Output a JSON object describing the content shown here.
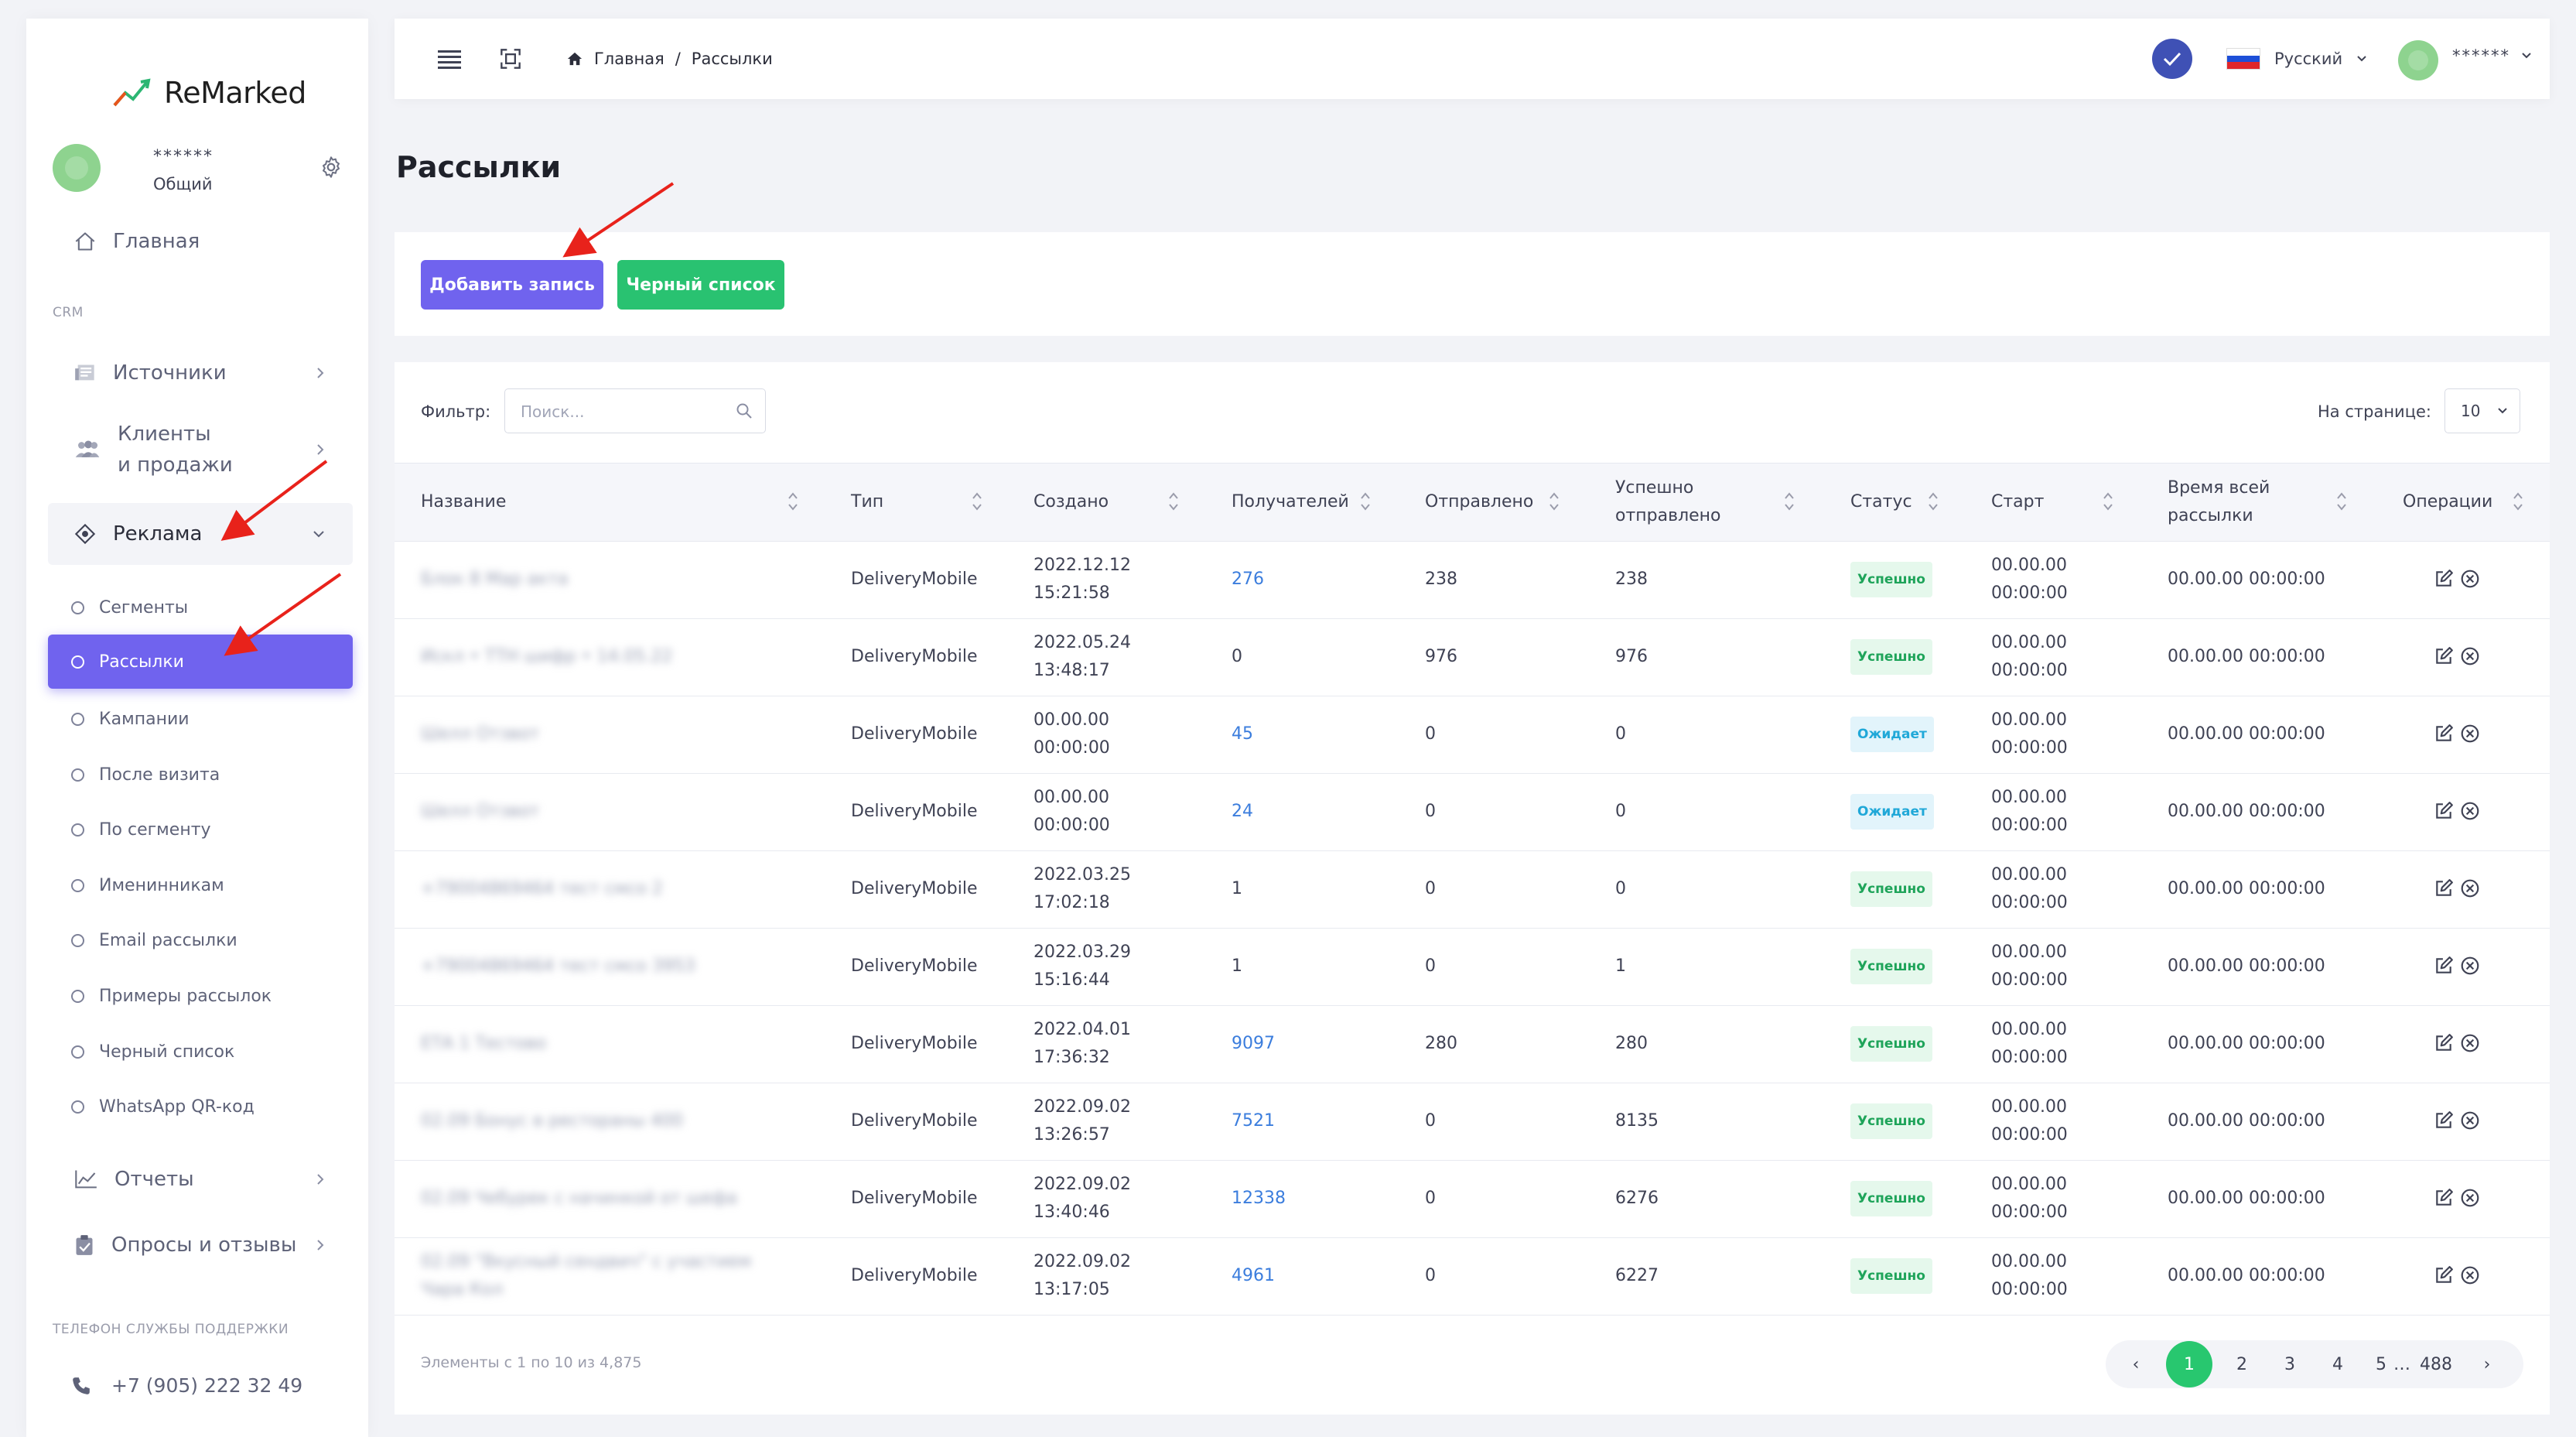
{
  "brand": {
    "name": "ReMarked"
  },
  "user": {
    "name": "******",
    "role": "Общий"
  },
  "sidebar": {
    "home": "Главная",
    "section_crm": "CRM",
    "sources": "Источники",
    "clients_line1": "Клиенты",
    "clients_line2": "и продажи",
    "ads": "Реклама",
    "sub_items": [
      "Сегменты",
      "Рассылки",
      "Кампании",
      "После визита",
      "По сегменту",
      "Именинникам",
      "Email рассылки",
      "Примеры рассылок",
      "Черный список",
      "WhatsApp QR-код"
    ],
    "reports": "Отчеты",
    "surveys": "Опросы и отзывы",
    "support_label": "ТЕЛЕФОН СЛУЖБЫ ПОДДЕРЖКИ",
    "support_phone": "+7 (905) 222 32 49"
  },
  "header": {
    "breadcrumb": [
      "Главная",
      "/",
      "Рассылки"
    ],
    "language": "Русский",
    "user": "******"
  },
  "page": {
    "title": "Рассылки",
    "add_button": "Добавить запись",
    "blacklist_button": "Черный список"
  },
  "table": {
    "filter_label": "Фильтр:",
    "search_placeholder": "Поиск...",
    "per_page_label": "На странице:",
    "per_page_value": "10",
    "columns": [
      {
        "l1": "Название",
        "l2": ""
      },
      {
        "l1": "Тип",
        "l2": ""
      },
      {
        "l1": "Создано",
        "l2": ""
      },
      {
        "l1": "Получателей",
        "l2": ""
      },
      {
        "l1": "Отправлено",
        "l2": ""
      },
      {
        "l1": "Успешно",
        "l2": "отправлено"
      },
      {
        "l1": "Статус",
        "l2": ""
      },
      {
        "l1": "Старт",
        "l2": ""
      },
      {
        "l1": "Время всей",
        "l2": "рассылки"
      },
      {
        "l1": "Операции",
        "l2": ""
      }
    ],
    "rows": [
      {
        "name": "Блок 8 Мар акта",
        "name2": "",
        "type": "DeliveryMobile",
        "created_date": "2022.12.12",
        "created_time": "15:21:58",
        "recipients": "276",
        "recipients_link": true,
        "sent": "238",
        "success": "238",
        "status": "Успешно",
        "status_kind": "ok",
        "start_date": "00.00.00",
        "start_time": "00:00:00",
        "total": "00.00.00 00:00:00"
      },
      {
        "name": "Искл • ТТН шифр • 14.05.22",
        "name2": "",
        "type": "DeliveryMobile",
        "created_date": "2022.05.24",
        "created_time": "13:48:17",
        "recipients": "0",
        "recipients_link": false,
        "sent": "976",
        "success": "976",
        "status": "Успешно",
        "status_kind": "ok",
        "start_date": "00.00.00",
        "start_time": "00:00:00",
        "total": "00.00.00 00:00:00"
      },
      {
        "name": "Шелл Отзвот",
        "name2": "",
        "type": "DeliveryMobile",
        "created_date": "00.00.00",
        "created_time": "00:00:00",
        "recipients": "45",
        "recipients_link": true,
        "sent": "0",
        "success": "0",
        "status": "Ожидает",
        "status_kind": "wait",
        "start_date": "00.00.00",
        "start_time": "00:00:00",
        "total": "00.00.00 00:00:00"
      },
      {
        "name": "Шелл Отзвот",
        "name2": "",
        "type": "DeliveryMobile",
        "created_date": "00.00.00",
        "created_time": "00:00:00",
        "recipients": "24",
        "recipients_link": true,
        "sent": "0",
        "success": "0",
        "status": "Ожидает",
        "status_kind": "wait",
        "start_date": "00.00.00",
        "start_time": "00:00:00",
        "total": "00.00.00 00:00:00"
      },
      {
        "name": "+79004869464 тест смсо 2",
        "name2": "",
        "type": "DeliveryMobile",
        "created_date": "2022.03.25",
        "created_time": "17:02:18",
        "recipients": "1",
        "recipients_link": false,
        "sent": "0",
        "success": "0",
        "status": "Успешно",
        "status_kind": "ok",
        "start_date": "00.00.00",
        "start_time": "00:00:00",
        "total": "00.00.00 00:00:00"
      },
      {
        "name": "+79004869464 тест смсо 3953",
        "name2": "",
        "type": "DeliveryMobile",
        "created_date": "2022.03.29",
        "created_time": "15:16:44",
        "recipients": "1",
        "recipients_link": false,
        "sent": "0",
        "success": "1",
        "status": "Успешно",
        "status_kind": "ok",
        "start_date": "00.00.00",
        "start_time": "00:00:00",
        "total": "00.00.00 00:00:00"
      },
      {
        "name": "ЕТА 1 Тестово",
        "name2": "",
        "type": "DeliveryMobile",
        "created_date": "2022.04.01",
        "created_time": "17:36:32",
        "recipients": "9097",
        "recipients_link": true,
        "sent": "280",
        "success": "280",
        "status": "Успешно",
        "status_kind": "ok",
        "start_date": "00.00.00",
        "start_time": "00:00:00",
        "total": "00.00.00 00:00:00"
      },
      {
        "name": "02.09 Бонус в рестораны 400",
        "name2": "",
        "type": "DeliveryMobile",
        "created_date": "2022.09.02",
        "created_time": "13:26:57",
        "recipients": "7521",
        "recipients_link": true,
        "sent": "0",
        "success": "8135",
        "status": "Успешно",
        "status_kind": "ok",
        "start_date": "00.00.00",
        "start_time": "00:00:00",
        "total": "00.00.00 00:00:00"
      },
      {
        "name": "02.09 Чебурек с начинкой от шефа",
        "name2": "",
        "type": "DeliveryMobile",
        "created_date": "2022.09.02",
        "created_time": "13:40:46",
        "recipients": "12338",
        "recipients_link": true,
        "sent": "0",
        "success": "6276",
        "status": "Успешно",
        "status_kind": "ok",
        "start_date": "00.00.00",
        "start_time": "00:00:00",
        "total": "00.00.00 00:00:00"
      },
      {
        "name": "02.09 \"Вкусный сендвич\" с участием",
        "name2": "Чара Кол",
        "type": "DeliveryMobile",
        "created_date": "2022.09.02",
        "created_time": "13:17:05",
        "recipients": "4961",
        "recipients_link": true,
        "sent": "0",
        "success": "6227",
        "status": "Успешно",
        "status_kind": "ok",
        "start_date": "00.00.00",
        "start_time": "00:00:00",
        "total": "00.00.00 00:00:00"
      }
    ],
    "footer_info": "Элементы с 1 по 10 из 4,875",
    "pagination": {
      "prev": "‹",
      "pages": [
        "1",
        "2",
        "3",
        "4",
        "5"
      ],
      "ellipsis": "…",
      "last": "488",
      "next": "›",
      "current": "1"
    }
  },
  "colors": {
    "accent": "#7063ee",
    "success": "#29c271",
    "link": "#3b7ddd",
    "annotation_arrow": "#e8221b"
  },
  "icons": [
    "logo-chart-icon",
    "gear-icon",
    "home-icon",
    "newspaper-icon",
    "users-icon",
    "target-icon",
    "chevron-right-icon",
    "chevron-down-icon",
    "chart-line-icon",
    "clipboard-icon",
    "phone-icon",
    "menu-icon",
    "expand-icon",
    "check-icon",
    "search-icon",
    "sort-icon",
    "edit-icon",
    "close-circle-icon"
  ]
}
